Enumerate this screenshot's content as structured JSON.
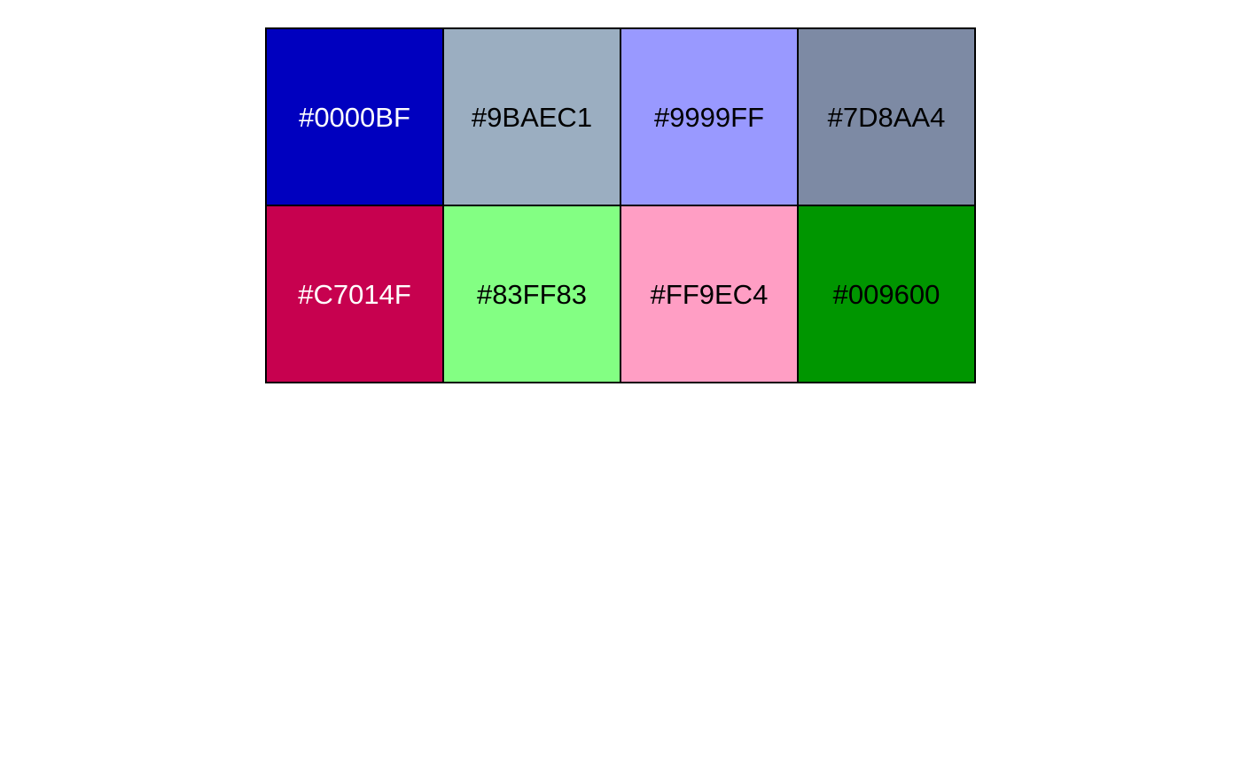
{
  "swatches": [
    {
      "label": "#0000BF",
      "color": "#0000BF",
      "text_color": "#FFFFFF"
    },
    {
      "label": "#9BAEC1",
      "color": "#9BAEC1",
      "text_color": "#000000"
    },
    {
      "label": "#9999FF",
      "color": "#9999FF",
      "text_color": "#000000"
    },
    {
      "label": "#7D8AA4",
      "color": "#7D8AA4",
      "text_color": "#000000"
    },
    {
      "label": "#C7014F",
      "color": "#C7014F",
      "text_color": "#FFFFFF"
    },
    {
      "label": "#83FF83",
      "color": "#83FF83",
      "text_color": "#000000"
    },
    {
      "label": "#FF9EC4",
      "color": "#FF9EC4",
      "text_color": "#000000"
    },
    {
      "label": "#009600",
      "color": "#009600",
      "text_color": "#000000"
    }
  ]
}
